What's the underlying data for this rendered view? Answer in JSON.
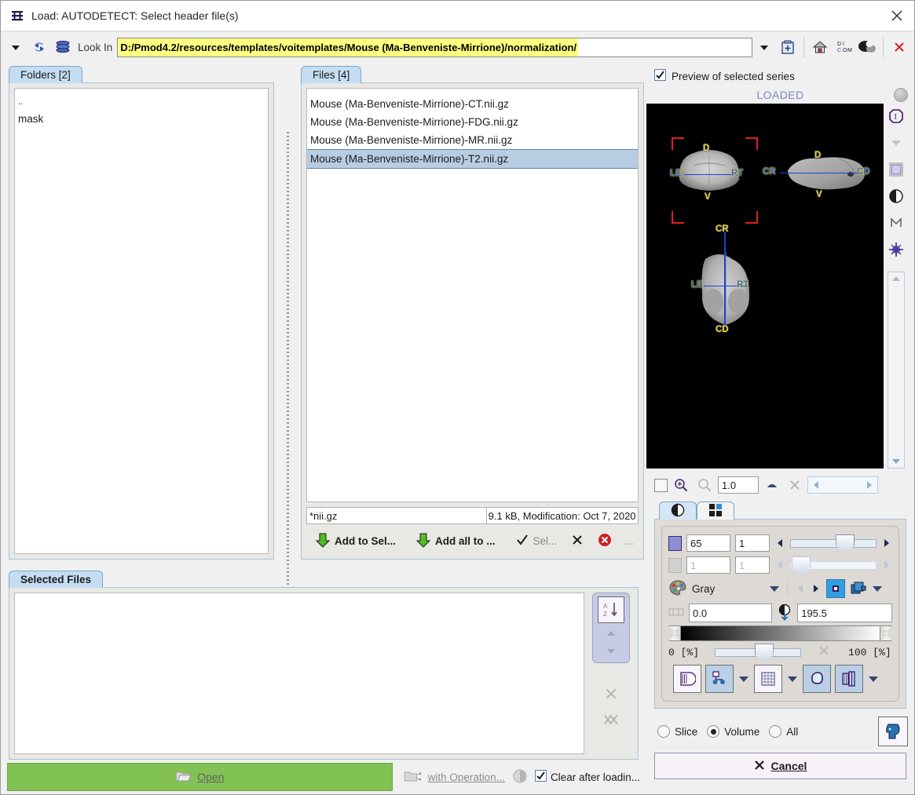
{
  "window": {
    "title": "Load: AUTODETECT: Select header file(s)",
    "title_icon": "pmod-logo-icon",
    "close_icon": "close-icon"
  },
  "pathbar": {
    "dropdown_icon": "chevron-down-icon",
    "refresh_icon": "refresh-icon",
    "database_icon": "database-icon",
    "lookin_label": "Look In",
    "path_value": "D:/Pmod4.2/resources/templates/voitemplates/Mouse (Ma-Benveniste-Mirrione)/normalization/",
    "combo_arrow_icon": "chevron-down-icon",
    "bookmark_icon": "bookmark-add-icon",
    "home_icon": "home-icon",
    "dicom_icon": "dicom-icon",
    "brain_icon": "brain-icon",
    "close_icon": "close-red-icon"
  },
  "folders": {
    "tab_label": "Folders [2]",
    "items": [
      "..",
      "mask"
    ]
  },
  "files": {
    "tab_label": "Files [4]",
    "items": [
      "Mouse (Ma-Benveniste-Mirrione)-CT.nii.gz",
      "Mouse (Ma-Benveniste-Mirrione)-FDG.nii.gz",
      "Mouse (Ma-Benveniste-Mirrione)-MR.nii.gz",
      "Mouse (Ma-Benveniste-Mirrione)-T2.nii.gz"
    ],
    "selected_index": 3,
    "filter_value": "*nii.gz",
    "file_info": "9.1 kB,  Modification: Oct 7, 2020",
    "actions": {
      "add_to_sel_label": "Add to Sel...",
      "add_to_sel_icon": "down-arrow-green-icon",
      "add_all_label": "Add all to ...",
      "add_all_icon": "down-arrow-green-icon",
      "select_label": "Sel...",
      "select_icon": "check-icon",
      "deselect_icon": "x-icon",
      "remove_icon": "delete-red-icon",
      "more_label": "..."
    }
  },
  "selected_files": {
    "tab_label": "Selected Files",
    "items": [],
    "sort_icon": "sort-az-icon",
    "up_icon": "triangle-up-icon",
    "down_icon": "triangle-down-icon",
    "remove_icon": "x-icon",
    "remove_all_icon": "x-all-icon"
  },
  "bottom": {
    "open_label": "Open",
    "open_icon": "folder-open-icon",
    "open_color": "#82c255",
    "with_operation_label": "with Operation...",
    "with_operation_icon": "folder-operation-icon",
    "info_icon": "progress-icon",
    "clear_label": "Clear after loadin...",
    "clear_checked": true
  },
  "preview": {
    "checkbox_label": "Preview of selected series",
    "checkbox_checked": true,
    "status": "LOADED",
    "status_color": "#7e86c6",
    "status_dot_icon": "status-dot-icon",
    "orientation_labels": {
      "coronal": [
        "D",
        "LE",
        "RT",
        "V"
      ],
      "sagittal": [
        "D",
        "CR",
        "CD",
        "V"
      ],
      "axial": [
        "CR",
        "LE",
        "RT",
        "CD"
      ]
    },
    "toolbar_icons": [
      "info-circle-icon",
      "chevron-down-icon",
      "layout-square-icon",
      "contrast-icon",
      "m-marker-icon",
      "crosshair-icon"
    ],
    "scroll_up_icon": "triangle-up-icon",
    "scroll_down_icon": "triangle-down-icon"
  },
  "zoomrow": {
    "checkbox_icon": "checkbox-icon",
    "zoom_in_icon": "zoom-in-icon",
    "zoom_out_icon": "zoom-out-icon",
    "zoom_value": "1.0",
    "triangle_icon": "triangle-icon",
    "close_icon": "x-icon",
    "prev_icon": "triangle-left-icon",
    "next_icon": "triangle-right-icon"
  },
  "settings": {
    "tabs": [
      {
        "name": "contrast-tab",
        "icon": "contrast-icon",
        "active": true
      },
      {
        "name": "layout-tab",
        "icon": "grid-4-icon",
        "active": false
      }
    ],
    "slice_slider": {
      "swatch_icon": "slice-color-icon",
      "value": "65",
      "step": "1",
      "enabled": true,
      "position_pct": 53
    },
    "frame_slider": {
      "swatch_icon": "frames-icon",
      "value": "1",
      "step": "1",
      "enabled": false,
      "position_pct": 2
    },
    "lut": {
      "palette_icon": "palette-icon",
      "name": "Gray",
      "dropdown_icon": "chevron-down-icon",
      "prev_icon": "triangle-left-icon",
      "next_icon": "triangle-right-icon",
      "invert_icon": "invert-lut-icon",
      "copy_icon": "copy-lut-icon",
      "menu_icon": "chevron-down-icon"
    },
    "window": {
      "min_icon": "range-icon",
      "min_value": "0.0",
      "contrast_icon": "contrast-drop-icon",
      "max_value": "195.5"
    },
    "gradient": {
      "left_pct_label": "0  [%]",
      "right_pct_label": "100  [%]",
      "slider_pct": 46,
      "reset_icon": "x-icon"
    },
    "tools": [
      {
        "name": "overlay-icon",
        "style": "light"
      },
      {
        "name": "vois-icon",
        "style": "blue"
      },
      {
        "name": "vois-menu-icon",
        "style": "caret"
      },
      {
        "name": "grid-icon",
        "style": "light"
      },
      {
        "name": "grid-menu-icon",
        "style": "caret"
      },
      {
        "name": "iso-contour-icon",
        "style": "blue"
      },
      {
        "name": "fusion-icon",
        "style": "blue"
      },
      {
        "name": "fusion-menu-icon",
        "style": "caret"
      }
    ]
  },
  "scope": {
    "options": [
      "Slice",
      "Volume",
      "All"
    ],
    "selected": "Volume",
    "head_icon": "head-profile-icon"
  },
  "cancel": {
    "label": "Cancel",
    "icon": "x-icon"
  }
}
